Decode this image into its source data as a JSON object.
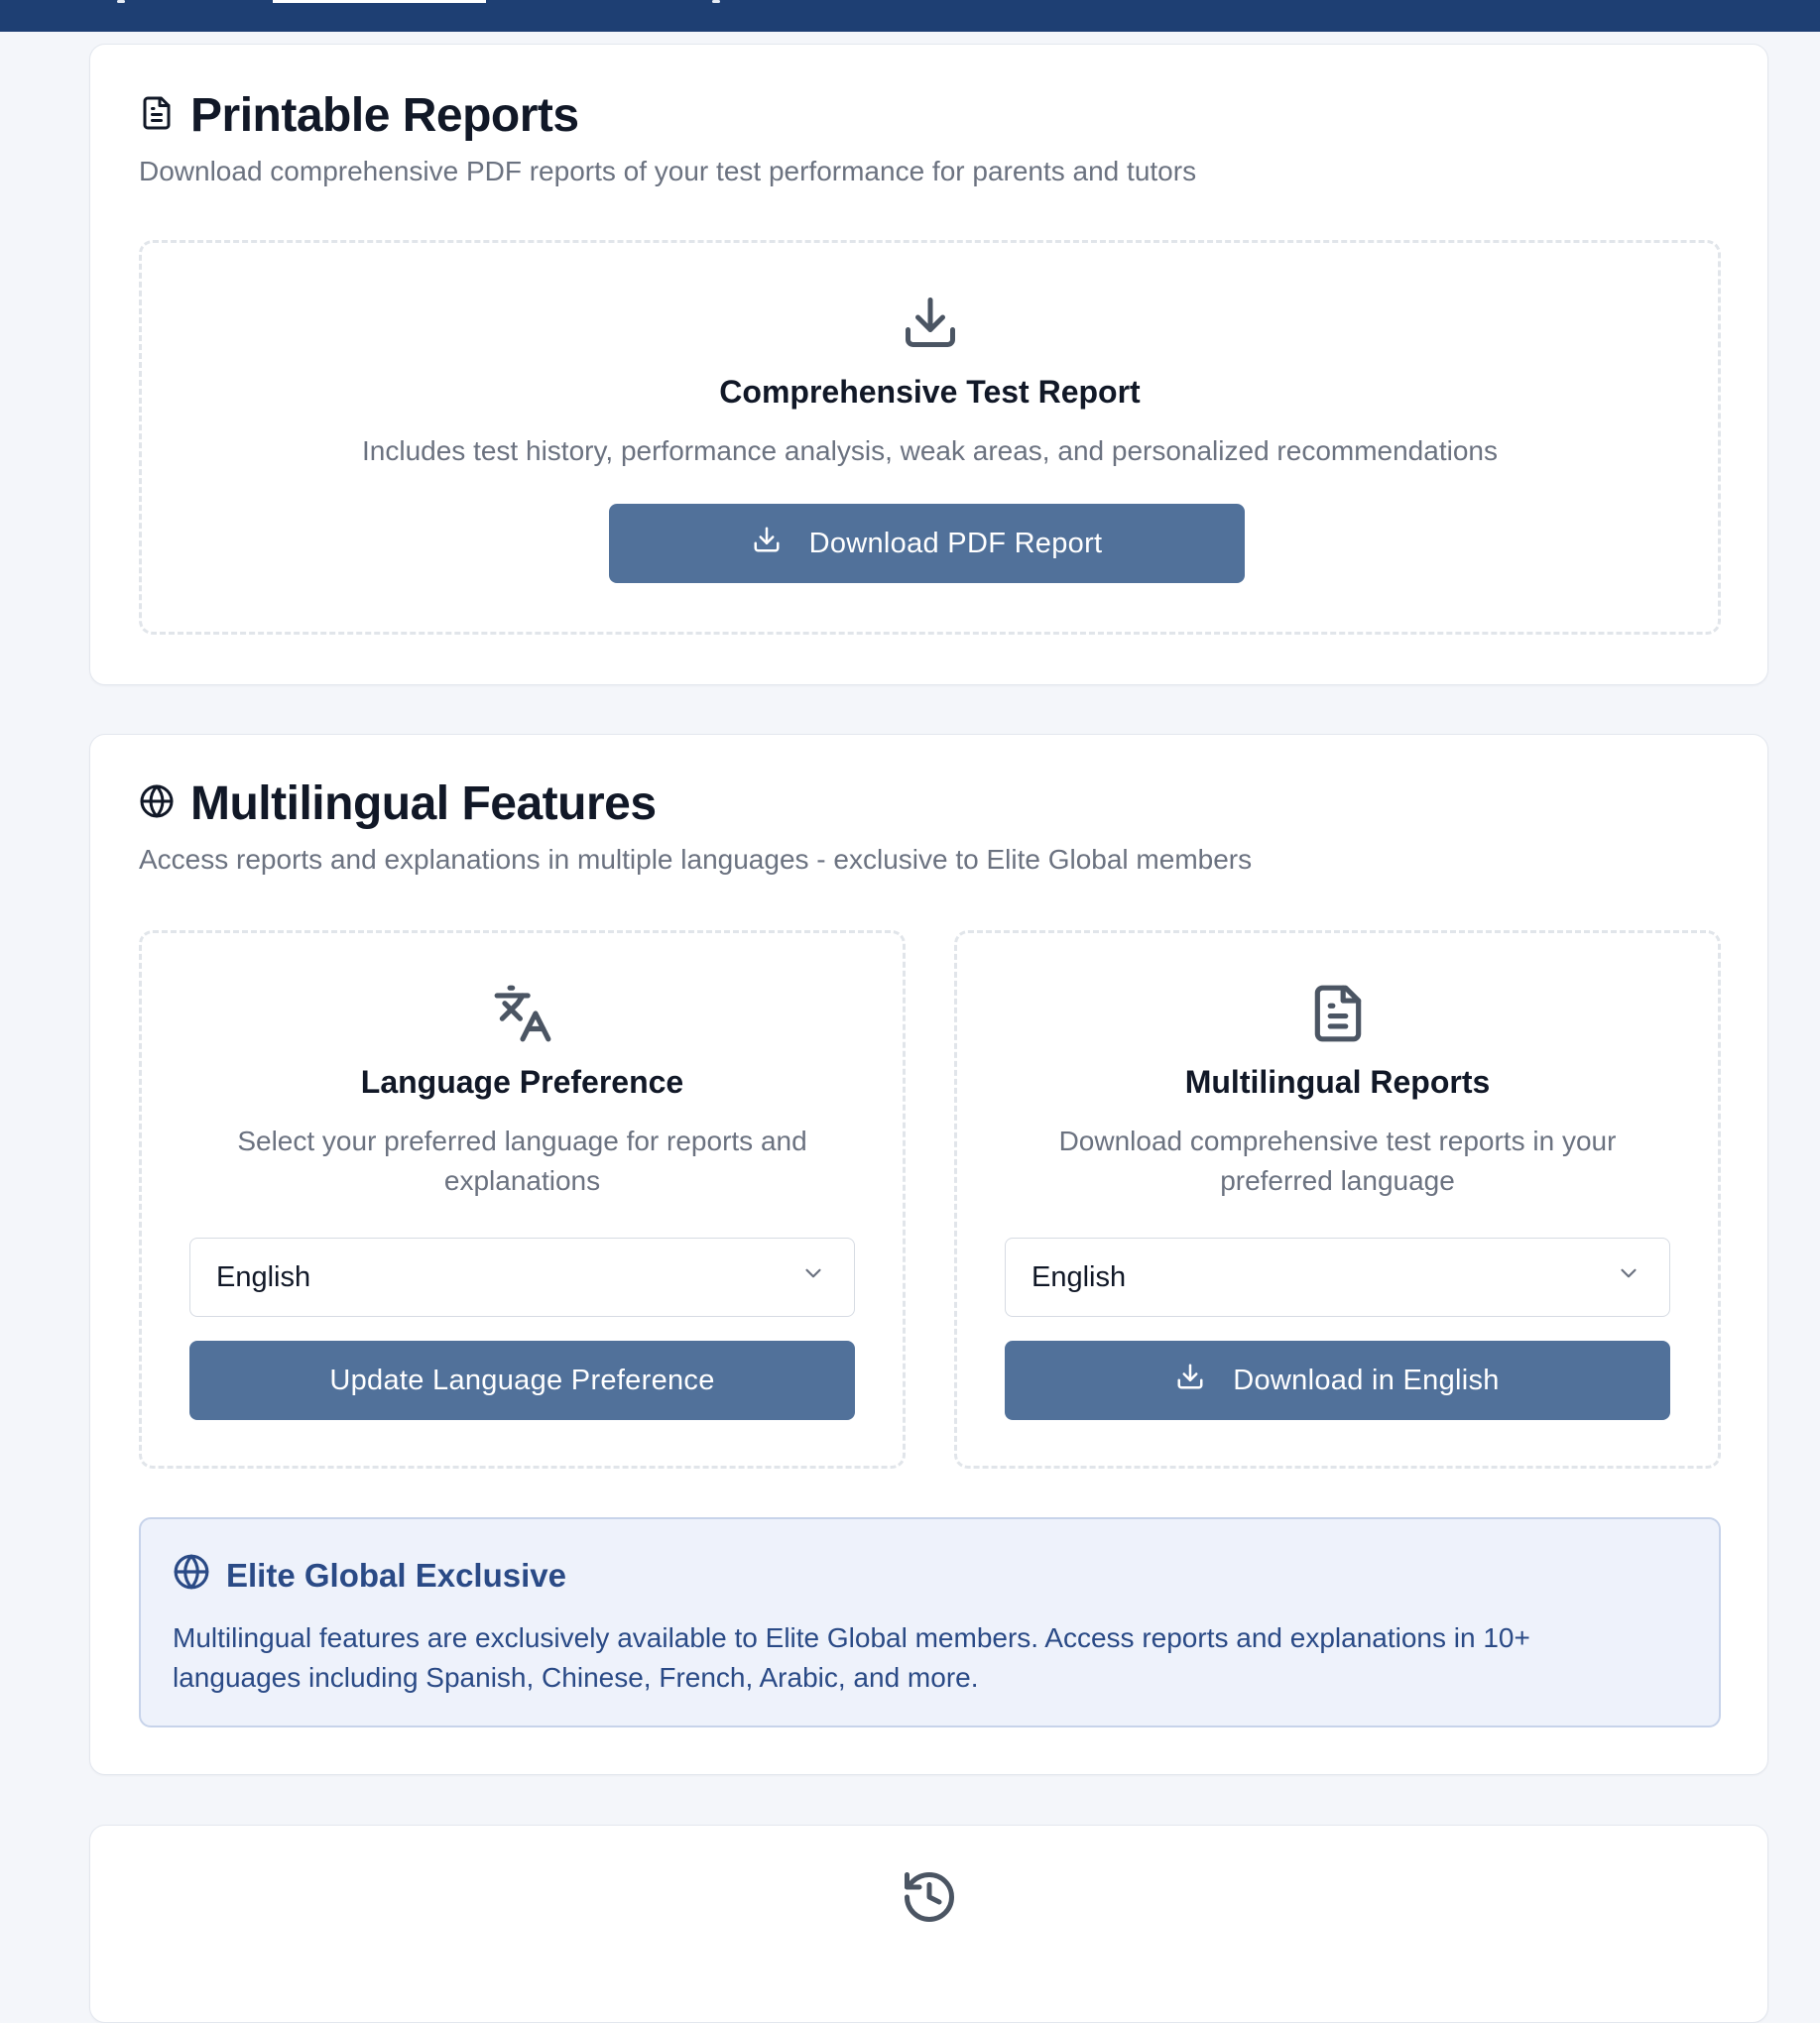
{
  "printable_reports": {
    "title": "Printable Reports",
    "subtitle": "Download comprehensive PDF reports of your test performance for parents and tutors",
    "report": {
      "title": "Comprehensive Test Report",
      "description": "Includes test history, performance analysis, weak areas, and personalized recommendations",
      "button_label": "Download PDF Report"
    }
  },
  "multilingual": {
    "title": "Multilingual Features",
    "subtitle": "Access reports and explanations in multiple languages - exclusive to Elite Global members",
    "language_preference": {
      "title": "Language Preference",
      "description": "Select your preferred language for reports and explanations",
      "selected": "English",
      "button_label": "Update Language Preference"
    },
    "reports": {
      "title": "Multilingual Reports",
      "description": "Download comprehensive test reports in your preferred language",
      "selected": "English",
      "button_label": "Download in English"
    },
    "notice": {
      "title": "Elite Global Exclusive",
      "body": "Multilingual features are exclusively available to Elite Global members. Access reports and explanations in 10+ languages including Spanish, Chinese, French, Arabic, and more."
    }
  },
  "icons": {
    "report": "file-text-icon",
    "download": "download-icon",
    "globe": "globe-icon",
    "translate": "languages-icon",
    "history": "history-icon"
  },
  "colors": {
    "header": "#1e3f73",
    "button": "#51719a",
    "notice_bg": "#eef2fb",
    "notice_text": "#2a4a86"
  }
}
